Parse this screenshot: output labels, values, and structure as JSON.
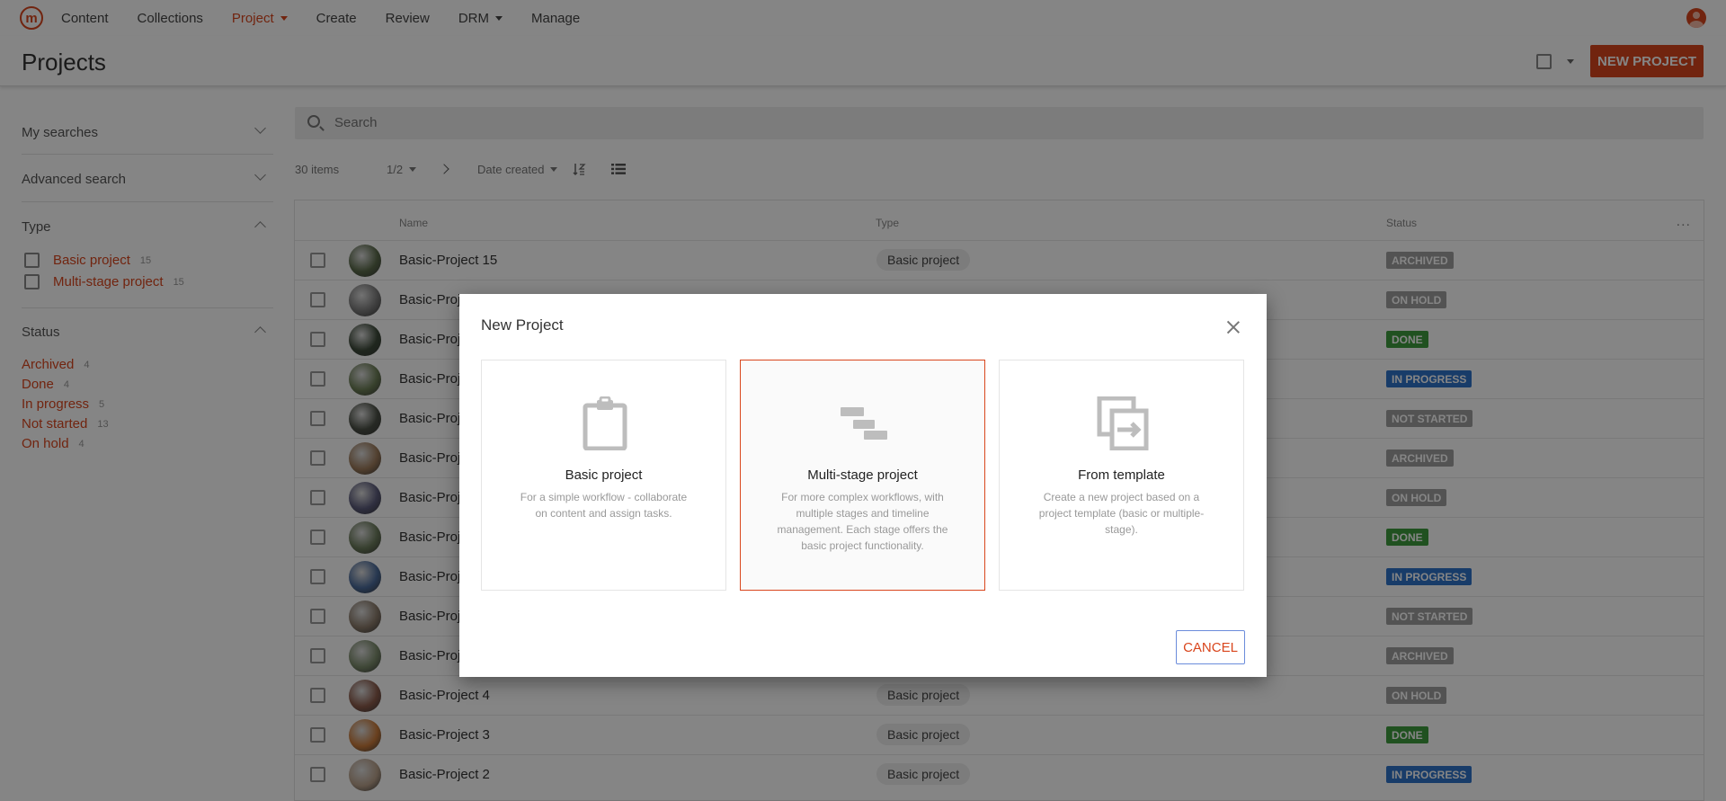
{
  "nav": {
    "items": [
      {
        "label": "Content"
      },
      {
        "label": "Collections"
      },
      {
        "label": "Project"
      },
      {
        "label": "Create"
      },
      {
        "label": "Review"
      },
      {
        "label": "DRM"
      },
      {
        "label": "Manage"
      }
    ]
  },
  "header": {
    "title": "Projects",
    "new_project_label": "NEW PROJECT"
  },
  "sidebar": {
    "my_searches": "My searches",
    "advanced_search": "Advanced search",
    "type_heading": "Type",
    "types": [
      {
        "label": "Basic project",
        "count": "15"
      },
      {
        "label": "Multi-stage project",
        "count": "15"
      }
    ],
    "status_heading": "Status",
    "statuses": [
      {
        "label": "Archived",
        "count": "4"
      },
      {
        "label": "Done",
        "count": "4"
      },
      {
        "label": "In progress",
        "count": "5"
      },
      {
        "label": "Not started",
        "count": "13"
      },
      {
        "label": "On hold",
        "count": "4"
      }
    ]
  },
  "search": {
    "placeholder": "Search"
  },
  "toolbar": {
    "items_count": "30 items",
    "page": "1/2",
    "sort_by": "Date created"
  },
  "table": {
    "columns": {
      "name": "Name",
      "type": "Type",
      "status": "Status"
    },
    "rows": [
      {
        "name": "Basic-Project 15",
        "type": "Basic project",
        "status": "ARCHIVED"
      },
      {
        "name": "Basic-Proj",
        "type": "",
        "status": "ON HOLD"
      },
      {
        "name": "Basic-Proj",
        "type": "",
        "status": "DONE"
      },
      {
        "name": "Basic-Proj",
        "type": "",
        "status": "IN PROGRESS"
      },
      {
        "name": "Basic-Proj",
        "type": "",
        "status": "NOT STARTED"
      },
      {
        "name": "Basic-Proj",
        "type": "",
        "status": "ARCHIVED"
      },
      {
        "name": "Basic-Proj",
        "type": "",
        "status": "ON HOLD"
      },
      {
        "name": "Basic-Proj",
        "type": "",
        "status": "DONE"
      },
      {
        "name": "Basic-Proj",
        "type": "",
        "status": "IN PROGRESS"
      },
      {
        "name": "Basic-Proj",
        "type": "",
        "status": "NOT STARTED"
      },
      {
        "name": "Basic-Proj",
        "type": "",
        "status": "ARCHIVED"
      },
      {
        "name": "Basic-Project 4",
        "type": "Basic project",
        "status": "ON HOLD"
      },
      {
        "name": "Basic-Project 3",
        "type": "Basic project",
        "status": "DONE"
      },
      {
        "name": "Basic-Project 2",
        "type": "Basic project",
        "status": "IN PROGRESS"
      }
    ]
  },
  "status_colors": {
    "ARCHIVED": "#a0a0a0",
    "ON HOLD": "#a0a0a0",
    "NOT STARTED": "#a0a0a0",
    "DONE": "#3e9b3e",
    "IN PROGRESS": "#2f74c9"
  },
  "avatar_colors": [
    "#5a6a4a",
    "#7a7a7a",
    "#3d4a3a",
    "#6b7d55",
    "#4a4f45",
    "#9c7a5a",
    "#5a5a7a",
    "#6a7a5a",
    "#4a6a9a",
    "#8a7a6a",
    "#7a8a6a",
    "#8a5a4a",
    "#c97a3a",
    "#b8a08a"
  ],
  "dialog": {
    "title": "New Project",
    "options": [
      {
        "title": "Basic project",
        "description": "For a simple workflow - collaborate on content and assign tasks."
      },
      {
        "title": "Multi-stage project",
        "description": "For more complex workflows, with multiple stages and timeline management. Each stage offers the basic project functionality."
      },
      {
        "title": "From template",
        "description": "Create a new project based on a project template (basic or multiple-stage)."
      }
    ],
    "cancel_label": "CANCEL"
  },
  "colors": {
    "accent": "#d9461d",
    "focus_ring": "#6b8cdb"
  }
}
